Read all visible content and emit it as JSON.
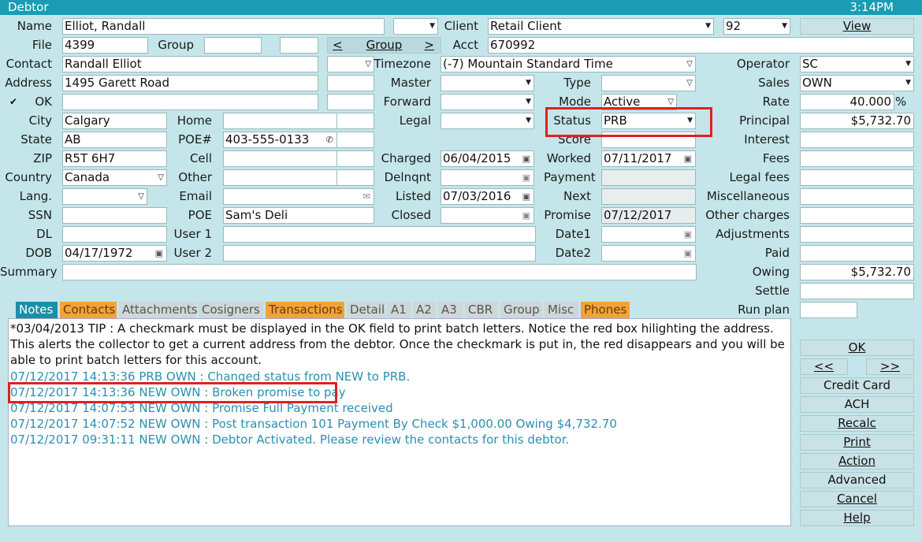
{
  "window": {
    "title": "Debtor",
    "time": "3:14PM"
  },
  "row1": {
    "name_label": "Name",
    "name_value": "Elliot, Randall",
    "client_label": "Client",
    "client_value": "Retail Client",
    "client_num": "92",
    "view_button": "View"
  },
  "row2": {
    "file_label": "File",
    "file_value": "4399",
    "group_label": "Group",
    "group_nav_prev": "<",
    "group_nav_label": "Group",
    "group_nav_next": ">",
    "acct_label": "Acct",
    "acct_value": "670992"
  },
  "row3": {
    "contact_label": "Contact",
    "contact_value": "Randall Elliot",
    "timezone_label": "Timezone",
    "timezone_value": "(-7) Mountain Standard Time",
    "operator_label": "Operator",
    "operator_value": "SC"
  },
  "row4": {
    "address_label": "Address",
    "address_value": "1495 Garett Road",
    "master_label": "Master",
    "type_label": "Type",
    "sales_label": "Sales",
    "sales_value": "OWN"
  },
  "row5": {
    "ok_check": "✔",
    "ok_label": "OK",
    "forward_label": "Forward",
    "mode_label": "Mode",
    "mode_value": "Active",
    "rate_label": "Rate",
    "rate_value": "40.000",
    "rate_unit": "%"
  },
  "row6": {
    "city_label": "City",
    "city_value": "Calgary",
    "home_label": "Home",
    "legal_label": "Legal",
    "status_label": "Status",
    "status_value": "PRB",
    "principal_label": "Principal",
    "principal_value": "$5,732.70"
  },
  "row7": {
    "state_label": "State",
    "state_value": "AB",
    "poe_num_label": "POE#",
    "poe_num_value": "403-555-0133",
    "score_label": "Score",
    "interest_label": "Interest"
  },
  "row8": {
    "zip_label": "ZIP",
    "zip_value": "R5T 6H7",
    "cell_label": "Cell",
    "charged_label": "Charged",
    "charged_value": "06/04/2015",
    "worked_label": "Worked",
    "worked_value": "07/11/2017",
    "fees_label": "Fees"
  },
  "row9": {
    "country_label": "Country",
    "country_value": "Canada",
    "other_label": "Other",
    "delnqnt_label": "Delnqnt",
    "payment_label": "Payment",
    "legal_fees_label": "Legal fees"
  },
  "row10": {
    "lang_label": "Lang.",
    "email_label": "Email",
    "listed_label": "Listed",
    "listed_value": "07/03/2016",
    "next_label": "Next",
    "misc_label": "Miscellaneous"
  },
  "row11": {
    "ssn_label": "SSN",
    "poe_label": "POE",
    "poe_value": "Sam's Deli",
    "closed_label": "Closed",
    "promise_label": "Promise",
    "promise_value": "07/12/2017",
    "other_charges_label": "Other charges"
  },
  "row12": {
    "dl_label": "DL",
    "user1_label": "User 1",
    "date1_label": "Date1",
    "adjustments_label": "Adjustments"
  },
  "row13": {
    "dob_label": "DOB",
    "dob_value": "04/17/1972",
    "user2_label": "User 2",
    "date2_label": "Date2",
    "paid_label": "Paid"
  },
  "row14": {
    "summary_label": "Summary",
    "owing_label": "Owing",
    "owing_value": "$5,732.70"
  },
  "row15": {
    "settle_label": "Settle",
    "runplan_label": "Run plan"
  },
  "tabs": [
    {
      "label": "Notes",
      "style": "active"
    },
    {
      "label": "Contacts",
      "style": "orange"
    },
    {
      "label": "Attachments",
      "style": "gray"
    },
    {
      "label": "Cosigners",
      "style": "gray"
    },
    {
      "label": "Transactions",
      "style": "orange"
    },
    {
      "label": "Detail",
      "style": "gray"
    },
    {
      "label": "A1",
      "style": "gray"
    },
    {
      "label": "A2",
      "style": "gray"
    },
    {
      "label": "A3",
      "style": "gray"
    },
    {
      "label": "CBR",
      "style": "gray"
    },
    {
      "label": "Group",
      "style": "gray"
    },
    {
      "label": "Misc",
      "style": "gray"
    },
    {
      "label": "Phones",
      "style": "orange"
    }
  ],
  "notes": {
    "tip": "*03/04/2013 TIP : A checkmark must be displayed in the OK field to print batch letters. Notice the red box hilighting the address. This alerts the collector to get a current address from the debtor. Once the checkmark is put in, the red disappears and you will be able to print batch letters for this account.",
    "lines": [
      "07/12/2017 14:13:36 PRB OWN : Changed status from NEW to PRB.",
      "07/12/2017 14:13:36 NEW OWN : Broken promise to pay",
      "07/12/2017 14:07:53 NEW OWN : Promise Full Payment received",
      "07/12/2017 14:07:52 NEW OWN : Post transaction 101 Payment By Check $1,000.00 Owing $4,732.70",
      "07/12/2017 09:31:11 NEW OWN : Debtor Activated. Please review the contacts for this debtor."
    ]
  },
  "actions": {
    "ok": "OK",
    "prev": "<<",
    "next": ">>",
    "credit_card": "Credit Card",
    "ach": "ACH",
    "recalc": "Recalc",
    "print": "Print",
    "action": "Action",
    "advanced": "Advanced",
    "cancel": "Cancel",
    "help": "Help"
  },
  "colors": {
    "accent": "#199cb4",
    "background": "#c4e6ea",
    "highlight": "#e0201f",
    "tab_orange": "#f2a23a"
  }
}
